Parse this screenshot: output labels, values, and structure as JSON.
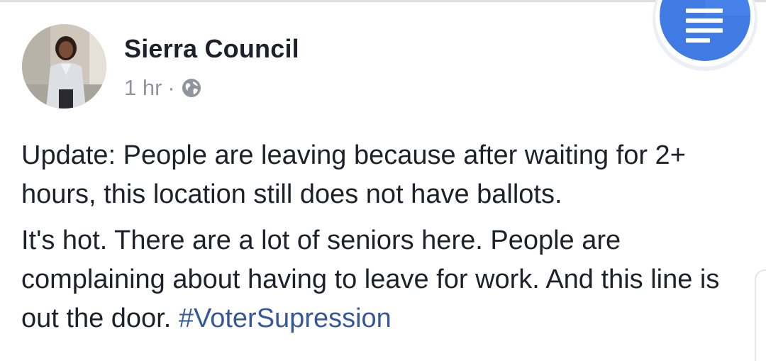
{
  "post": {
    "author": "Sierra Council",
    "time": "1 hr",
    "separator": "·",
    "audience_icon": "globe-icon",
    "paragraph1": "Update: People are leaving because after waiting for 2+ hours, this location still does not have ballots.",
    "paragraph2_text": "It's hot. There are a lot of seniors here. People are complaining about having to leave for work. And this line is out the door. ",
    "hashtag": "#VoterSupression"
  },
  "floating_button": {
    "icon": "notes-icon",
    "color": "#4285f4"
  },
  "colors": {
    "text": "#1d2129",
    "meta": "#90949c",
    "hashtag": "#365899"
  }
}
